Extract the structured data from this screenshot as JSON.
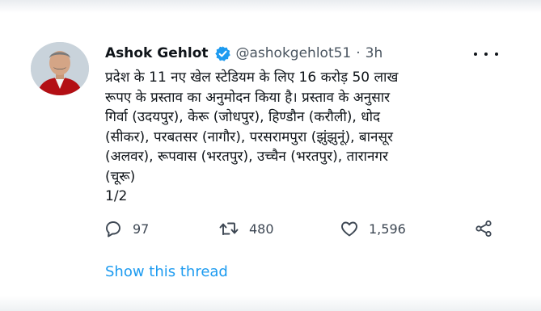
{
  "tweet": {
    "author_name": "Ashok Gehlot",
    "handle": "@ashokgehlot51",
    "separator": "·",
    "time": "3h",
    "body_lines": [
      "प्रदेश के 11 नए खेल स्टेडियम के लिए 16 करोड़ 50 लाख",
      "रूपए के प्रस्ताव का अनुमोदन किया है। प्रस्ताव के अनुसार",
      "गिर्वा (उदयपुर), केरू (जोधपुर), हिण्डौन (करौली), धोद",
      "(सीकर), परबतसर (नागौर), परसरामपुरा (झुंझुनूं), बानसूर",
      "(अलवर), रूपवास (भरतपुर), उच्चैन (भरतपुर), तारानगर",
      "(चूरू)",
      "1/2"
    ]
  },
  "actions": {
    "reply_count": "97",
    "retweet_count": "480",
    "like_count": "1,596"
  },
  "thread_link": "Show this thread",
  "icons": [
    "verified-icon",
    "more-icon",
    "reply-icon",
    "retweet-icon",
    "like-icon",
    "share-icon"
  ],
  "colors": {
    "accent": "#1d9bf0",
    "text": "#0f1419",
    "muted": "#4a5560"
  }
}
